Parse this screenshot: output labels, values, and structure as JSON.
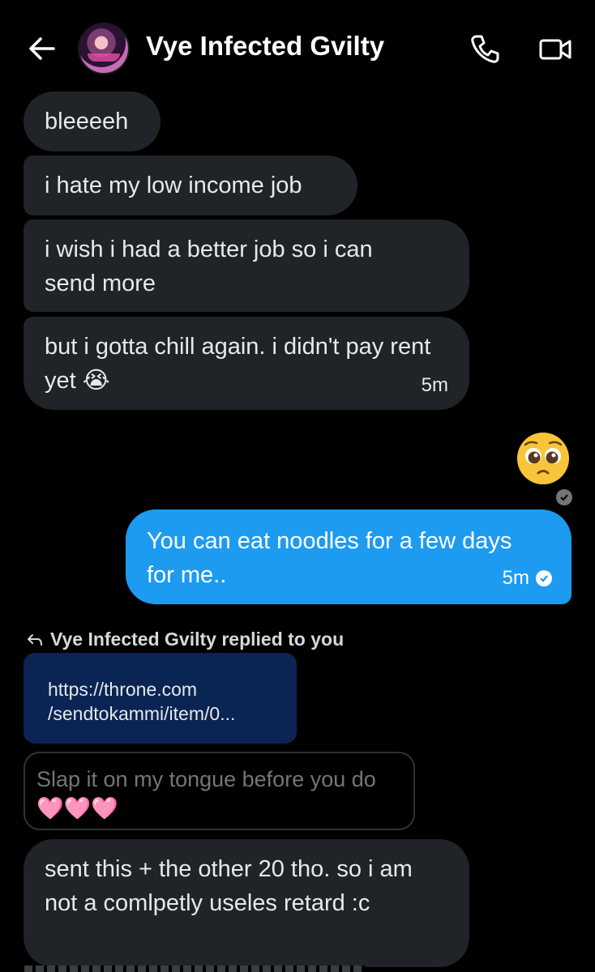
{
  "header": {
    "title": "Vye Infected Gvilty",
    "back_icon": "arrow-left-icon",
    "call_icon": "phone-icon",
    "video_icon": "video-camera-icon"
  },
  "messages": {
    "m1": "bleeeeh",
    "m2": "i hate my low income job",
    "m3": "i wish i had a better job so i can send more",
    "m4": "but i gotta chill again. i didn't pay rent yet 😭",
    "m4_time": "5m",
    "reaction_emoji": "🥺",
    "outgoing": "You can eat noodles for a few days for me..",
    "outgoing_time": "5m",
    "reply_label": "Vye Infected Gvilty replied to you",
    "link_line1": "https://throne.com",
    "link_line2": "/sendtokammi/item/0...",
    "quoted": "Slap it on my tongue before you do 🩷🩷🩷",
    "m5": "sent this + the other 20 tho. so i am not a comlpetly useles retard :c"
  },
  "colors": {
    "incoming_bubble": "#202327",
    "outgoing_bubble": "#1d9bf0",
    "link_card": "#0a2453",
    "background": "#000000"
  }
}
